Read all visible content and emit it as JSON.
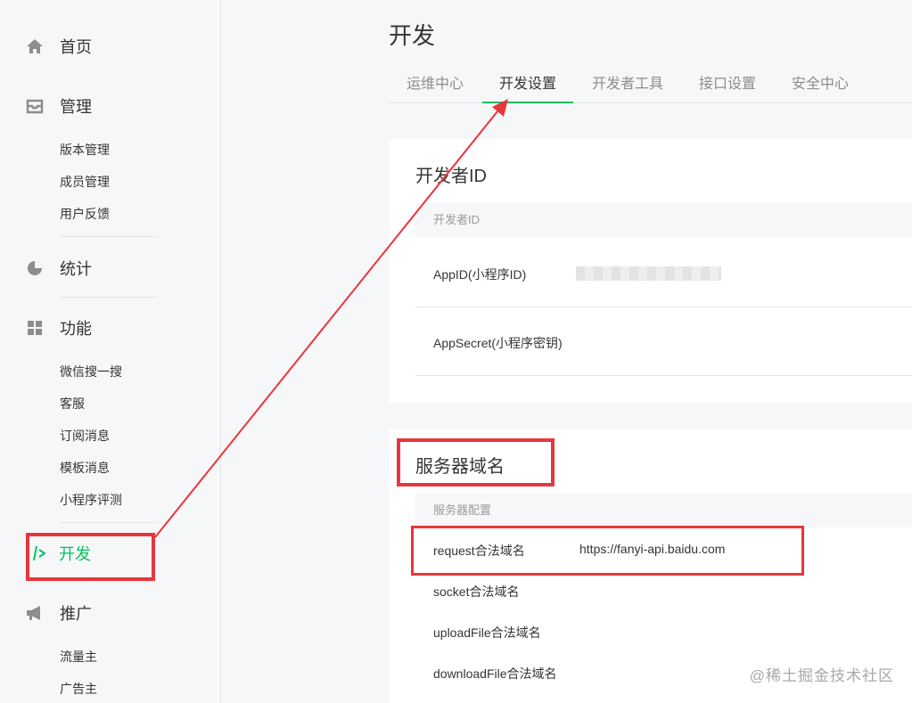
{
  "sidebar": {
    "items": [
      {
        "label": "首页",
        "icon": "home-icon"
      },
      {
        "label": "管理",
        "icon": "inbox-icon"
      },
      {
        "label": "统计",
        "icon": "pie-chart-icon"
      },
      {
        "label": "功能",
        "icon": "grid-icon"
      },
      {
        "label": "开发",
        "icon": "code-icon"
      },
      {
        "label": "推广",
        "icon": "megaphone-icon"
      }
    ],
    "manage_sub": [
      "版本管理",
      "成员管理",
      "用户反馈"
    ],
    "feature_sub": [
      "微信搜一搜",
      "客服",
      "订阅消息",
      "模板消息",
      "小程序评测"
    ],
    "promo_sub": [
      "流量主",
      "广告主"
    ]
  },
  "header": {
    "title": "开发"
  },
  "tabs": [
    "运维中心",
    "开发设置",
    "开发者工具",
    "接口设置",
    "安全中心"
  ],
  "developer_id": {
    "title": "开发者ID",
    "section_head": "开发者ID",
    "rows": [
      {
        "label": "AppID(小程序ID)"
      },
      {
        "label": "AppSecret(小程序密钥)"
      }
    ]
  },
  "server_domain": {
    "title": "服务器域名",
    "section_head": "服务器配置",
    "rows": [
      {
        "label": "request合法域名",
        "value": "https://fanyi-api.baidu.com"
      },
      {
        "label": "socket合法域名",
        "value": ""
      },
      {
        "label": "uploadFile合法域名",
        "value": ""
      },
      {
        "label": "downloadFile合法域名",
        "value": ""
      }
    ]
  },
  "watermark": "@稀土掘金技术社区",
  "colors": {
    "accent": "#07c160",
    "annotation": "#e8363c"
  }
}
